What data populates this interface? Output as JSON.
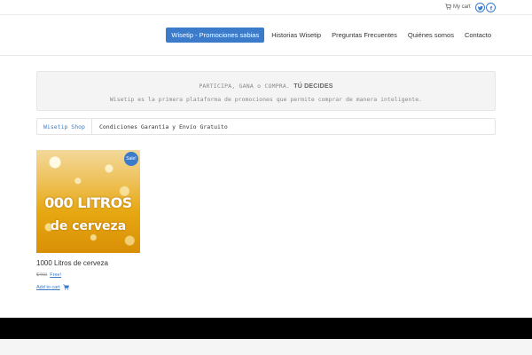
{
  "topbar": {
    "cart_label": "My cart",
    "social": [
      "twitter-icon",
      "facebook-icon"
    ]
  },
  "nav": {
    "items": [
      {
        "label": "Wisetip - Promociones sabias",
        "active": true
      },
      {
        "label": "Historias Wisetip"
      },
      {
        "label": "Preguntas Frecuentes"
      },
      {
        "label": "Quiénes somos"
      },
      {
        "label": "Contacto"
      }
    ]
  },
  "promo": {
    "line1": "PARTICIPA, GANA o COMPRA.",
    "line1_bold": "TÚ DECIDES",
    "line2": "Wisetip es la primera plataforma de promociones que permite comprar de manera inteligente."
  },
  "breadcrumb": {
    "link": "Wisetip Shop",
    "current": "Condiciones Garantía y Envío Gratuito"
  },
  "product": {
    "image_text_line1": "000 LITROS",
    "image_text_line2": "de cerveza",
    "badge": "Sale!",
    "title": "1000 Litros de cerveza",
    "old_price": "$460",
    "new_price": "Free!",
    "add_to_cart": "Add to cart"
  },
  "colors": {
    "accent": "#3b7bc9",
    "footer": "#000000"
  }
}
